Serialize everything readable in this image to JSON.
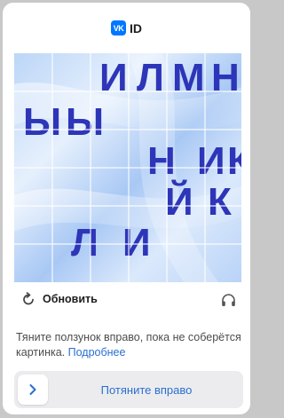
{
  "brand": {
    "logo_mark": "VK",
    "label": "ID"
  },
  "captcha": {
    "fragments": [
      "И",
      "Л",
      "М",
      "Н",
      "Ы",
      "Ы",
      "Н",
      "И",
      "К",
      "Й",
      "К",
      "Л",
      "И"
    ],
    "letter_color": "#2d35b8"
  },
  "refresh": {
    "label": "Обновить",
    "icon": "refresh-icon"
  },
  "audio": {
    "icon": "headphones-icon"
  },
  "hint": {
    "text": "Тяните ползунок вправо, пока не соберётся картинка.",
    "link": "Подробнее"
  },
  "slider": {
    "label": "Потяните вправо",
    "handle_icon": "chevron-right-icon"
  },
  "colors": {
    "accent": "#2a6fcf",
    "vk_blue": "#0077ff"
  }
}
